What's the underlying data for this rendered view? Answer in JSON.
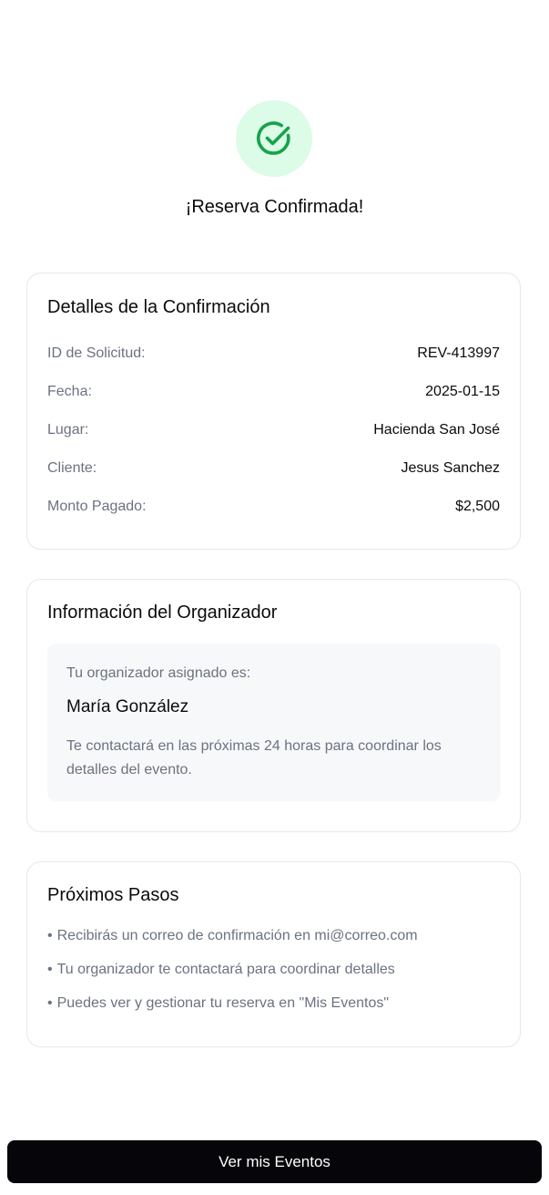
{
  "header": {
    "icon": "check-circle-icon",
    "title": "¡Reserva Confirmada!"
  },
  "details_card": {
    "title": "Detalles de la Confirmación",
    "rows": [
      {
        "label": "ID de Solicitud:",
        "value": "REV-413997"
      },
      {
        "label": "Fecha:",
        "value": "2025-01-15"
      },
      {
        "label": "Lugar:",
        "value": "Hacienda San José"
      },
      {
        "label": "Cliente:",
        "value": "Jesus Sanchez"
      },
      {
        "label": "Monto Pagado:",
        "value": "$2,500"
      }
    ]
  },
  "organizer_card": {
    "title": "Información del Organizador",
    "caption": "Tu organizador asignado es:",
    "name": "María González",
    "note": "Te contactará en las próximas 24 horas para coordinar los detalles del evento."
  },
  "steps_card": {
    "title": "Próximos Pasos",
    "bullet": "•",
    "items": [
      "Recibirás un correo de confirmación en mi@correo.com",
      "Tu organizador te contactará para coordinar detalles",
      "Puedes ver y gestionar tu reserva en \"Mis Eventos\""
    ]
  },
  "footer": {
    "button_label": "Ver mis Eventos"
  },
  "colors": {
    "success_green": "#16a34a",
    "success_bg": "#dcfce7",
    "button_bg": "#05050a",
    "muted_text": "#6b7280",
    "card_border": "#e5e7eb"
  }
}
